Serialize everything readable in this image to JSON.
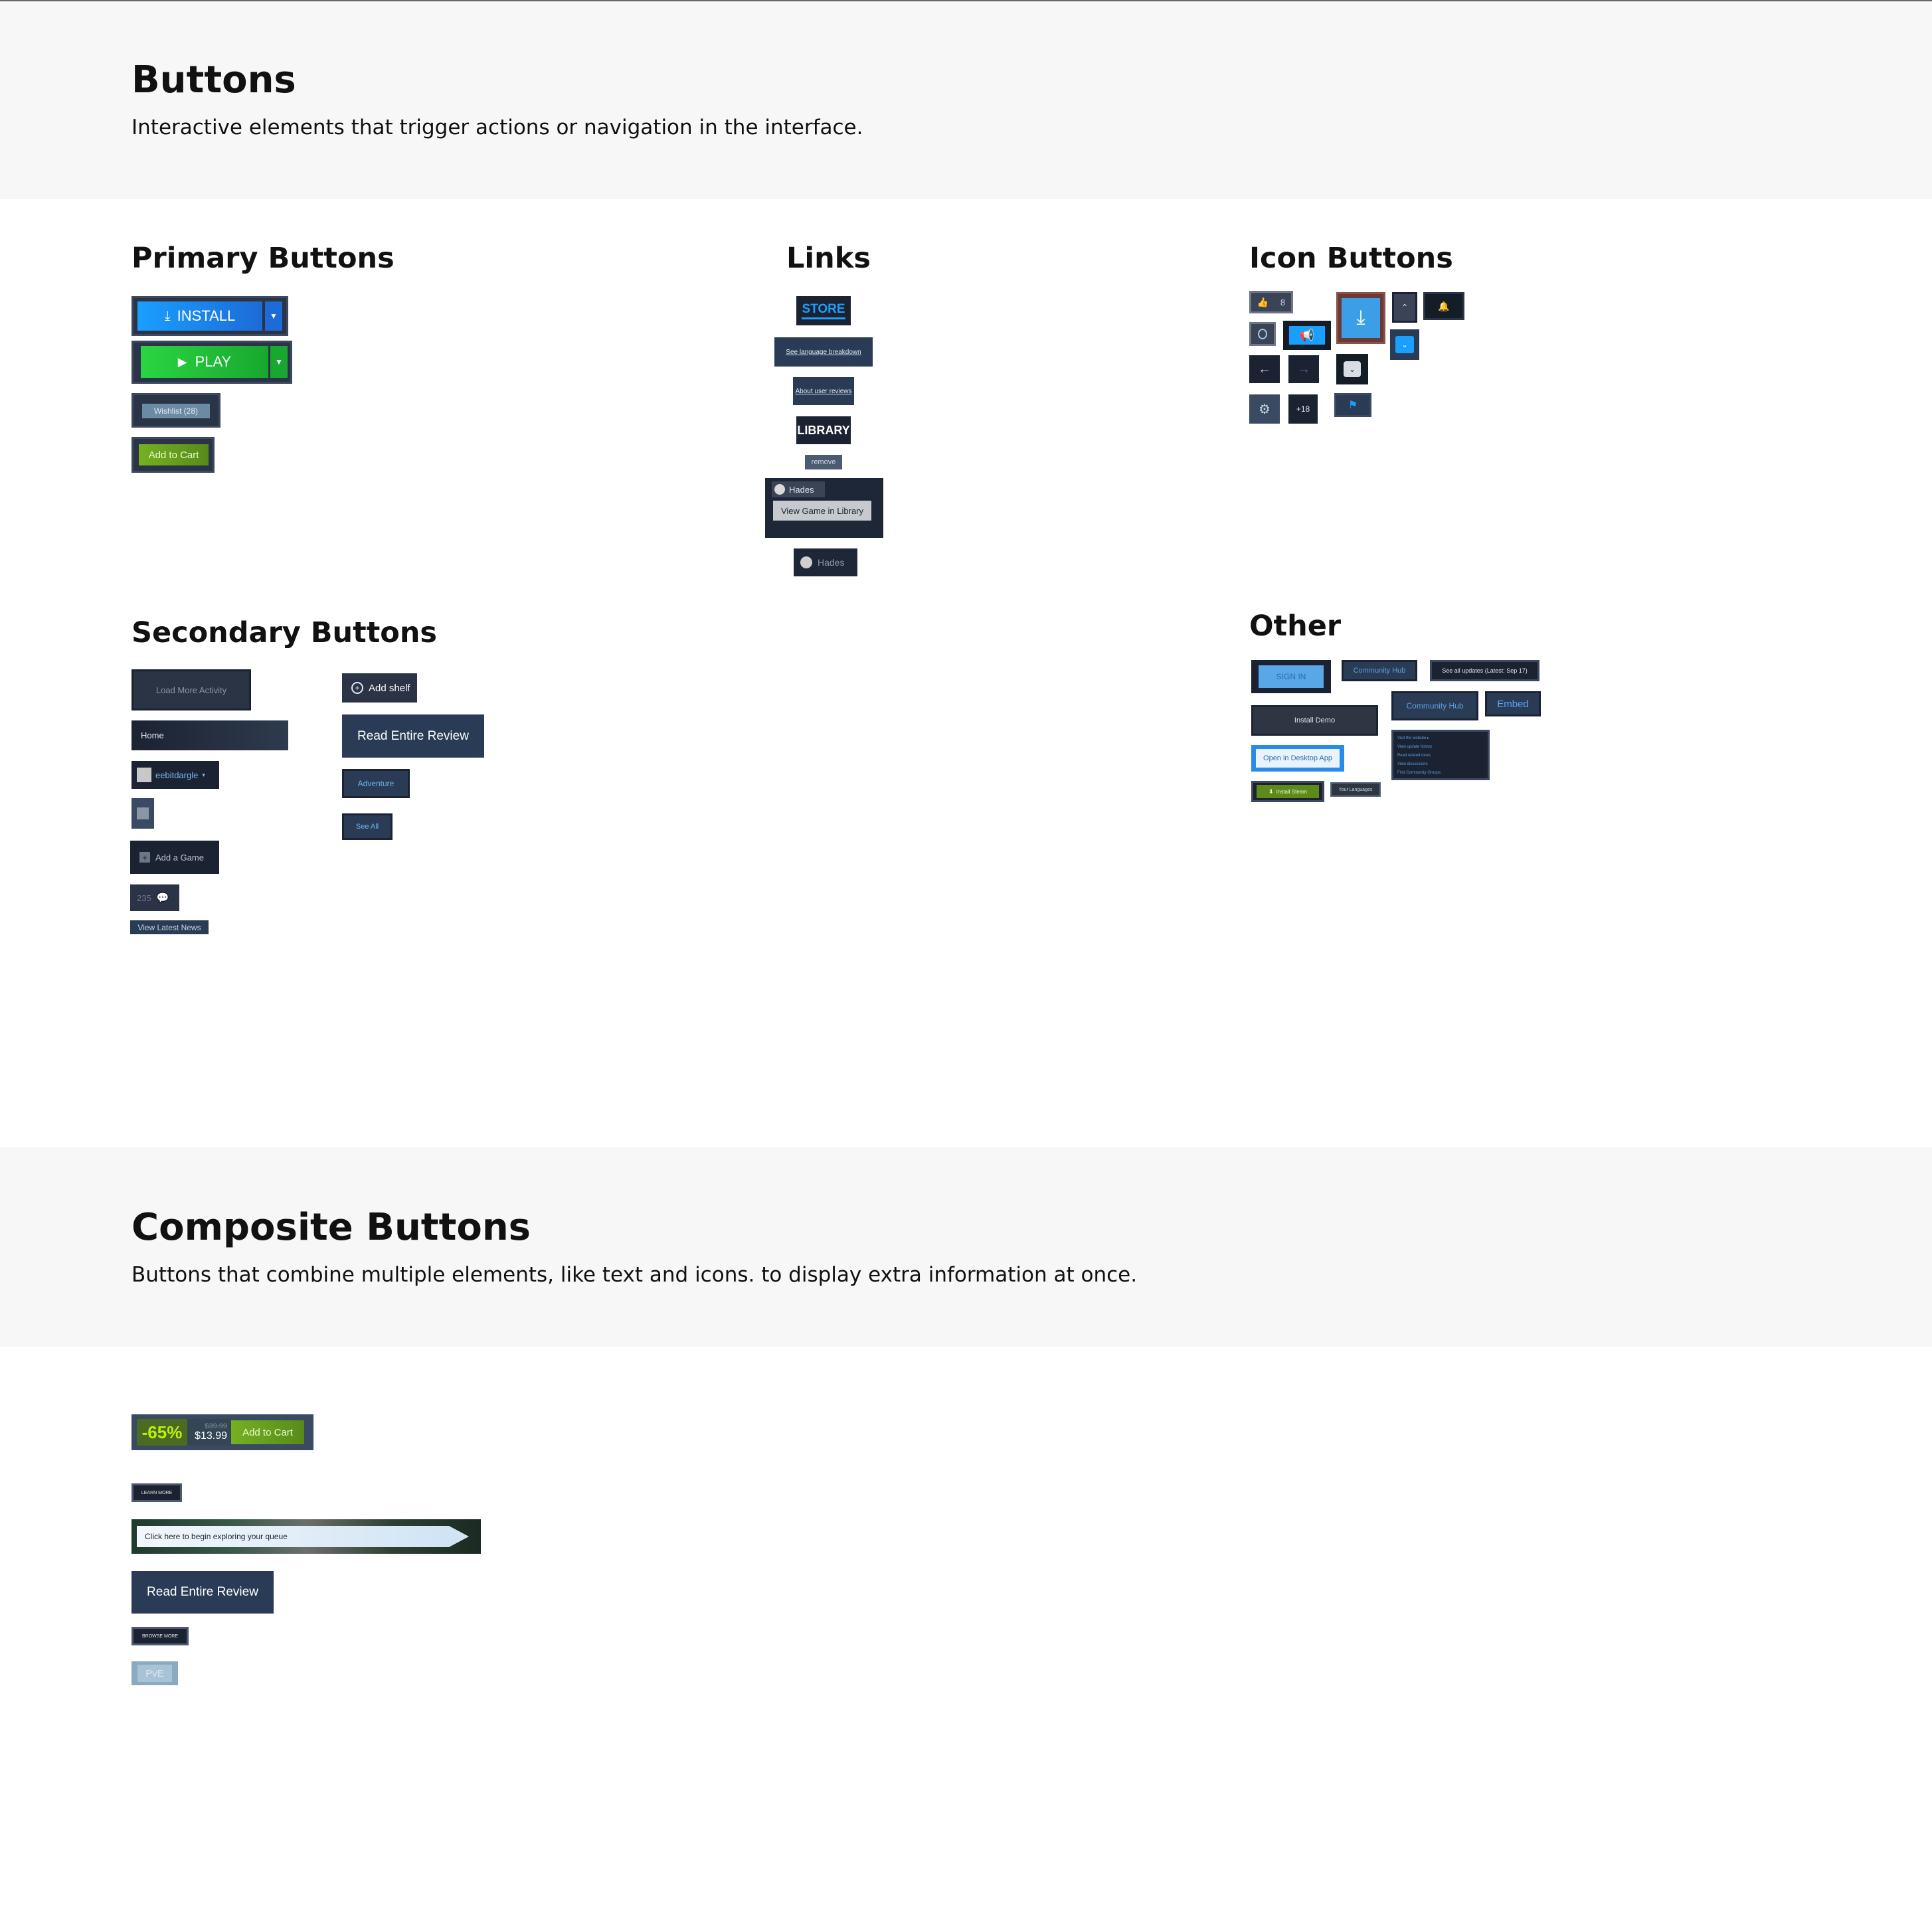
{
  "header": {
    "title": "Buttons",
    "description": "Interactive elements that trigger actions or navigation in the interface."
  },
  "primary": {
    "heading": "Primary Buttons",
    "install_label": "INSTALL",
    "play_label": "PLAY",
    "wishlist_label": "Wishlist (28)",
    "add_to_cart_label": "Add to Cart"
  },
  "links": {
    "heading": "Links",
    "store": "STORE",
    "language_breakdown": "See language breakdown",
    "about_reviews": "About user reviews",
    "library": "LIBRARY",
    "remove": "remove",
    "game_name": "Hades",
    "view_in_library": "View Game in Library",
    "game_name_2": "Hades"
  },
  "icon_buttons": {
    "heading": "Icon Buttons",
    "thumbs_count": "8",
    "plus_count": "+18"
  },
  "secondary": {
    "heading": "Secondary Buttons",
    "load_more": "Load More Activity",
    "home": "Home",
    "username": "eebitdargle",
    "add_game": "Add a Game",
    "comment_count": "235",
    "view_news": "View Latest News",
    "add_shelf": "Add shelf",
    "read_review": "Read Entire Review",
    "adventure": "Adventure",
    "see_all": "See All"
  },
  "other": {
    "heading": "Other",
    "sign_in": "SIGN IN",
    "community_hub": "Community Hub",
    "see_updates": "See all updates (Latest: Sep 17)",
    "install_demo": "Install Demo",
    "community_hub_2": "Community Hub",
    "embed": "Embed",
    "open_desktop": "Open in Desktop App",
    "install_steam": "Install Steam",
    "your_languages": "Your Languages",
    "menu_items": [
      "Visit the website ▸",
      "View update history",
      "Read related news",
      "View discussions",
      "Find Community Groups"
    ]
  },
  "composite": {
    "title": "Composite Buttons",
    "description": "Buttons that combine multiple elements, like text and icons. to display extra information at once.",
    "discount": "-65%",
    "original_price": "$39.99",
    "final_price": "$13.99",
    "add_to_cart": "Add to Cart",
    "learn_more": "LEARN MORE",
    "queue_label": "Click here to begin exploring your queue",
    "read_review": "Read Entire Review",
    "browse_more": "BROWSE MORE",
    "pve": "PvE"
  },
  "colors": {
    "steam_blue": "#1a9fff",
    "play_green": "#1ec13a",
    "cart_green": "#6fa71f",
    "dark_panel": "#1b2332",
    "mid_panel": "#2a3c55",
    "discount_text": "#beee11"
  }
}
